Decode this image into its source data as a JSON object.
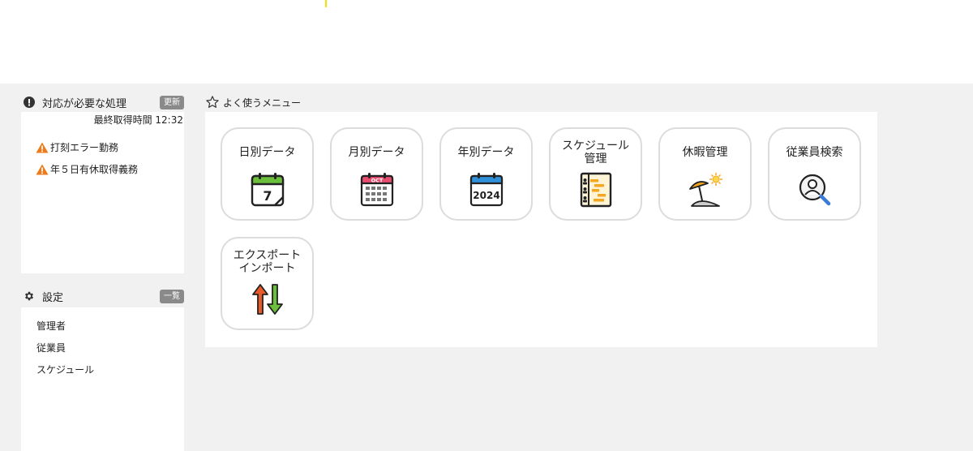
{
  "todo_panel": {
    "title": "対応が必要な処理",
    "refresh_label": "更新",
    "last_fetched": "最終取得時間 12:32",
    "items": [
      {
        "label": "打刻エラー勤務",
        "icon": "warning-icon"
      },
      {
        "label": "年５日有休取得義務",
        "icon": "warning-icon"
      }
    ]
  },
  "settings_panel": {
    "title": "設定",
    "list_label": "一覧",
    "items": [
      {
        "label": "管理者"
      },
      {
        "label": "従業員"
      },
      {
        "label": "スケジュール"
      }
    ]
  },
  "menu": {
    "title": "よく使うメニュー",
    "tiles": [
      {
        "label": "日別データ",
        "icon": "calendar-day-icon",
        "icon_text": "7"
      },
      {
        "label": "月別データ",
        "icon": "calendar-month-icon",
        "icon_text": "OCT"
      },
      {
        "label": "年別データ",
        "icon": "calendar-year-icon",
        "icon_text": "2024"
      },
      {
        "label": "スケジュール\n管理",
        "icon": "schedule-chart-icon"
      },
      {
        "label": "休暇管理",
        "icon": "beach-umbrella-icon"
      },
      {
        "label": "従業員検索",
        "icon": "user-search-icon"
      },
      {
        "label": "エクスポート\nインポート",
        "icon": "export-import-arrows-icon"
      }
    ]
  },
  "colors": {
    "background": "#f1f1f1",
    "badge": "#8a8a8a",
    "tile_border": "#dcdcdc",
    "warning": "#ee7a1a"
  }
}
